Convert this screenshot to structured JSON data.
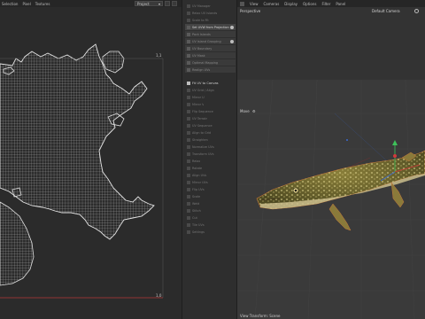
{
  "uv_editor": {
    "menu": [
      "Selection",
      "Pixel",
      "Textures"
    ],
    "dropdown_value": "Project",
    "coord_top_right": "1,1",
    "coord_bottom_right": "1,0"
  },
  "tool_panel": {
    "items_top": [
      {
        "label": "UV Manager",
        "active": false
      },
      {
        "label": "Relax UV Islands",
        "active": false
      },
      {
        "label": "Scale to Fit",
        "active": false
      }
    ],
    "items_mid": [
      {
        "label": "Set UVW from Projection",
        "active": true,
        "help": true
      },
      {
        "label": "Pack Islands",
        "active": false
      },
      {
        "label": "UV Island Grouping",
        "active": false,
        "help": true
      },
      {
        "label": "UV Boundary",
        "active": false
      },
      {
        "label": "UV Mask",
        "active": false
      },
      {
        "label": "Optimal Mapping",
        "active": false
      },
      {
        "label": "Realign UVs",
        "active": false
      }
    ],
    "section_header": "Fit UV to Canvas",
    "items_bottom": [
      "UV Grid / Align",
      "Mirror U",
      "Mirror V",
      "Flip Sequence",
      "UV Terrain",
      "UV Sequence",
      "Align to Grid",
      "Straighten",
      "Normalize UVs",
      "Transform UVs",
      "Relax",
      "Rotate",
      "Align UVs",
      "Mirror UVs",
      "Flip UVs",
      "Scale",
      "Weld",
      "Stitch",
      "Cut",
      "Tile UVs",
      "Settings"
    ]
  },
  "viewport": {
    "menu": [
      "View",
      "Cameras",
      "Display",
      "Options",
      "Filter",
      "Panel"
    ],
    "label_left": "Perspective",
    "label_camera": "Default Camera",
    "label_move": "Move",
    "bottom_status": "View Transform: Scene"
  },
  "colors": {
    "uv_wire": "#d8d8d8",
    "uv_red_line": "#b33a3a",
    "fish_body": "#6e6a2e",
    "axis_y": "#3ec25a",
    "axis_x": "#d03a3a",
    "axis_z": "#3a6ad0"
  }
}
